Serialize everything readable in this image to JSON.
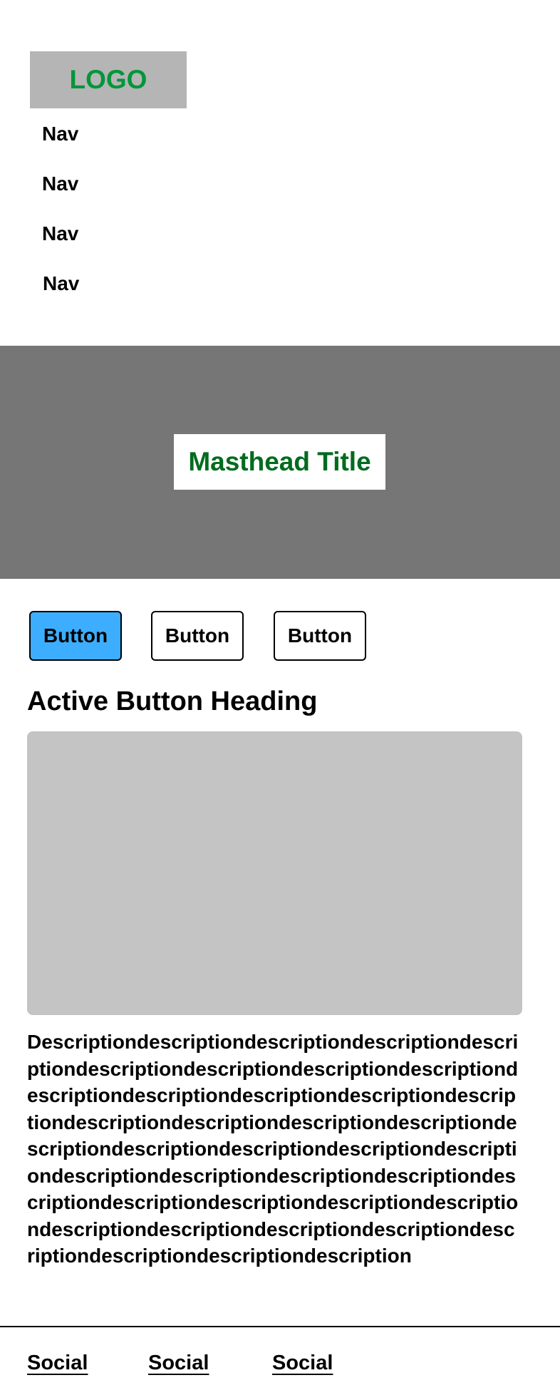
{
  "header": {
    "logo": "LOGO",
    "logo_color": "#00963a",
    "logo_bg": "#b5b5b5",
    "nav": [
      "Nav",
      "Nav",
      "Nav",
      "Nav"
    ]
  },
  "masthead": {
    "title": "Masthead Title",
    "title_color": "#006b1e",
    "bg": "#767676"
  },
  "buttons": [
    {
      "label": "Button",
      "active": true
    },
    {
      "label": "Button",
      "active": false
    },
    {
      "label": "Button",
      "active": false
    }
  ],
  "active_color": "#3daeff",
  "content": {
    "heading": "Active Button Heading",
    "description": "Descriptiondescriptiondescriptiondescriptiondescriptiondescriptiondescriptiondescriptiondescriptiondescriptiondescriptiondescriptiondescriptiondescriptiondescriptiondescriptiondescriptiondescriptiondescriptiondescriptiondescriptiondescriptiondescriptiondescriptiondescriptiondescriptiondescriptiondescriptiondescriptiondescriptiondescriptiondescriptiondescriptiondescriptiondescriptiondescriptiondescriptiondescriptiondescriptiondescription"
  },
  "footer": {
    "social": [
      "Social",
      "Social",
      "Social"
    ]
  }
}
